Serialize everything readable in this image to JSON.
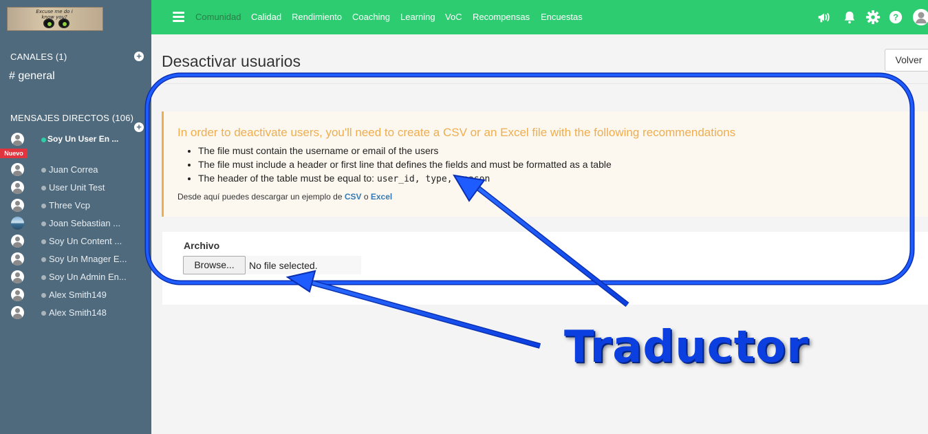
{
  "logo": {
    "text": "Excuse me do i know you?"
  },
  "sidebar": {
    "channels_title": "CANALES (1)",
    "channels": [
      "# general"
    ],
    "dm_title": "MENSAJES DIRECTOS (106)",
    "new_badge": "Nuevo",
    "dms": [
      {
        "label": "Soy Un User En ...",
        "status": "online"
      },
      {
        "label": "Juan Correa",
        "status": "offline"
      },
      {
        "label": "User Unit Test",
        "status": "offline"
      },
      {
        "label": "Three Vcp",
        "status": "offline"
      },
      {
        "label": "Joan Sebastian ...",
        "status": "offline"
      },
      {
        "label": "Soy Un Content ...",
        "status": "offline"
      },
      {
        "label": "Soy Un Mnager E...",
        "status": "offline"
      },
      {
        "label": "Soy Un Admin En...",
        "status": "offline"
      },
      {
        "label": "Alex Smith149",
        "status": "offline"
      },
      {
        "label": "Alex Smith148",
        "status": "offline"
      }
    ]
  },
  "topbar": {
    "nav": [
      "Comunidad",
      "Calidad",
      "Rendimiento",
      "Coaching",
      "Learning",
      "VoC",
      "Recompensas",
      "Encuestas"
    ],
    "active_index": 0,
    "icons": [
      "megaphone-icon",
      "bell-icon",
      "gear-icon",
      "help-icon",
      "user-avatar-icon"
    ],
    "color": "#2ecc71"
  },
  "main": {
    "title": "Desactivar usuarios",
    "back_label": "Volver",
    "alert": {
      "title": "In order to deactivate users, you'll need to create a CSV or an Excel file with the following recommendations",
      "items": [
        "The file must contain the username or email of the users",
        "The file must include a header or first line that defines the fields and must be formatted as a table"
      ],
      "header_item_prefix": "The header of the table must be equal to: ",
      "header_item_code": "user_id, type, reason",
      "note_prefix": "Desde aquí puedes descargar un ejemplo de ",
      "csv_link": "CSV",
      "note_joiner": " o ",
      "excel_link": "Excel"
    },
    "form": {
      "file_label": "Archivo",
      "browse_label": "Browse...",
      "file_status": "No file selected."
    }
  },
  "annotation": {
    "text": "Traductor",
    "color": "#0b3fe0"
  }
}
